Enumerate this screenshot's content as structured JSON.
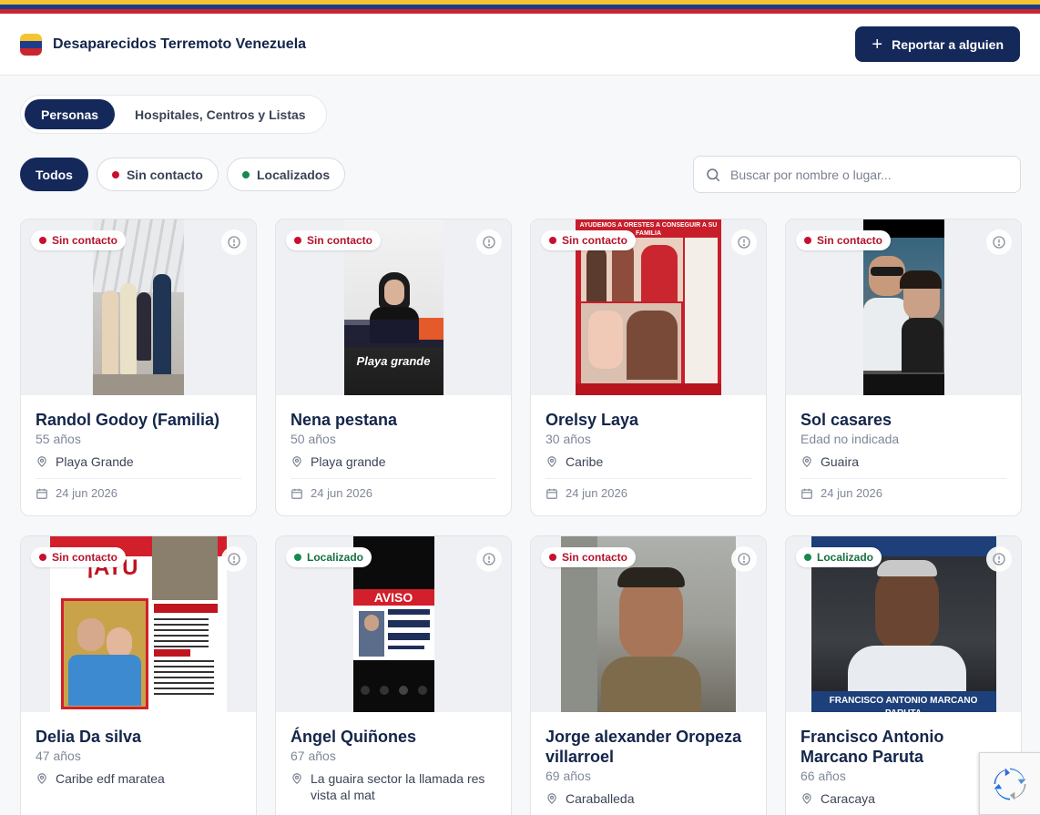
{
  "header": {
    "title": "Desaparecidos Terremoto Venezuela",
    "report_label": "Reportar a alguien",
    "flag_colors": [
      "#f4c531",
      "#1d3c8c",
      "#c9262f"
    ]
  },
  "view_tabs": [
    {
      "label": "Personas",
      "active": true
    },
    {
      "label": "Hospitales, Centros y Listas",
      "active": false
    }
  ],
  "filters": [
    {
      "label": "Todos",
      "active": true
    },
    {
      "label": "Sin contacto",
      "dot": "red"
    },
    {
      "label": "Localizados",
      "dot": "green"
    }
  ],
  "search": {
    "placeholder": "Buscar por nombre o lugar..."
  },
  "cards": [
    {
      "status": "Sin contacto",
      "status_type": "red",
      "name": "Randol Godoy (Familia)",
      "age": "55 años",
      "location": "Playa Grande",
      "date": "24 jun 2026"
    },
    {
      "status": "Sin contacto",
      "status_type": "red",
      "name": "Nena pestana",
      "age": "50 años",
      "location": "Playa grande",
      "date": "24 jun 2026",
      "photo_caption": "Playa grande"
    },
    {
      "status": "Sin contacto",
      "status_type": "red",
      "name": "Orelsy Laya",
      "age": "30 años",
      "location": "Caribe",
      "date": "24 jun 2026",
      "photo_caption": "AYUDEMOS A ORESTES A CONSEGUIR A SU FAMILIA"
    },
    {
      "status": "Sin contacto",
      "status_type": "red",
      "name": "Sol casares",
      "age": "Edad no indicada",
      "location": "Guaira",
      "date": "24 jun 2026"
    },
    {
      "status": "Sin contacto",
      "status_type": "red",
      "name": "Delia Da silva",
      "age": "47 años",
      "location": "Caribe edf maratea",
      "date": "",
      "photo_caption": "¡AYU"
    },
    {
      "status": "Localizado",
      "status_type": "green",
      "name": "Ángel Quiñones",
      "age": "67 años",
      "location": "La guaira sector la llamada res vista al mat",
      "date": "",
      "photo_caption": "AVISO"
    },
    {
      "status": "Sin contacto",
      "status_type": "red",
      "name": "Jorge alexander Oropeza villarroel",
      "age": "69 años",
      "location": "Caraballeda",
      "date": ""
    },
    {
      "status": "Localizado",
      "status_type": "green",
      "name": "Francisco Antonio Marcano Paruta",
      "age": "66 años",
      "location": "Caracaya",
      "date": "",
      "photo_caption": "FRANCISCO ANTONIO MARCANO PARUTA"
    }
  ]
}
